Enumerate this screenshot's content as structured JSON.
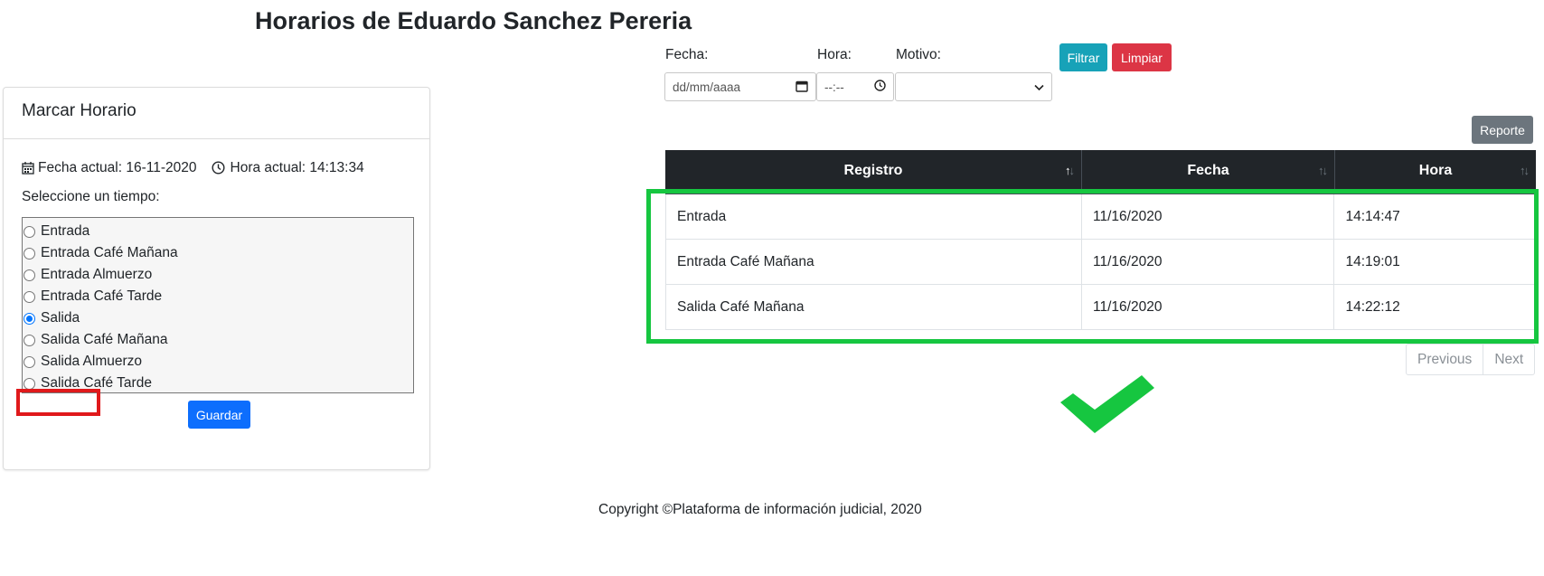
{
  "page": {
    "title": "Horarios de Eduardo Sanchez Pereria"
  },
  "marcar": {
    "header": "Marcar Horario",
    "fecha_actual": "Fecha actual: 16-11-2020",
    "hora_actual": "Hora actual: 14:13:34",
    "prompt": "Seleccione un tiempo:",
    "options": [
      {
        "label": "Entrada",
        "selected": false
      },
      {
        "label": "Entrada Café Mañana",
        "selected": false
      },
      {
        "label": "Entrada Almuerzo",
        "selected": false
      },
      {
        "label": "Entrada Café Tarde",
        "selected": false
      },
      {
        "label": "Salida",
        "selected": true
      },
      {
        "label": "Salida Café Mañana",
        "selected": false
      },
      {
        "label": "Salida Almuerzo",
        "selected": false
      },
      {
        "label": "Salida Café Tarde",
        "selected": false
      }
    ],
    "save_label": "Guardar"
  },
  "filters": {
    "fecha_label": "Fecha:",
    "fecha_placeholder": "dd/mm/aaaa",
    "hora_label": "Hora:",
    "hora_placeholder": "--:--",
    "motivo_label": "Motivo:",
    "motivo_value": "",
    "filter_label": "Filtrar",
    "clear_label": "Limpiar"
  },
  "report_label": "Reporte",
  "table": {
    "columns": [
      "Registro",
      "Fecha",
      "Hora"
    ],
    "rows": [
      [
        "Entrada",
        "11/16/2020",
        "14:14:47"
      ],
      [
        "Entrada Café Mañana",
        "11/16/2020",
        "14:19:01"
      ],
      [
        "Salida Café Mañana",
        "11/16/2020",
        "14:22:12"
      ]
    ]
  },
  "pagination": {
    "previous": "Previous",
    "next": "Next"
  },
  "footer": "Copyright ©Plataforma de información judicial, 2020",
  "colors": {
    "filter_button": "#17a2b8",
    "clear_button": "#dc3545",
    "save_button": "#0d6efd",
    "report_button": "#6c757d",
    "table_header": "#212529",
    "highlight_red": "#e0191b",
    "highlight_green": "#16c640"
  },
  "icons": [
    "calendar-icon",
    "clock-icon",
    "sort-icon",
    "check-icon"
  ]
}
